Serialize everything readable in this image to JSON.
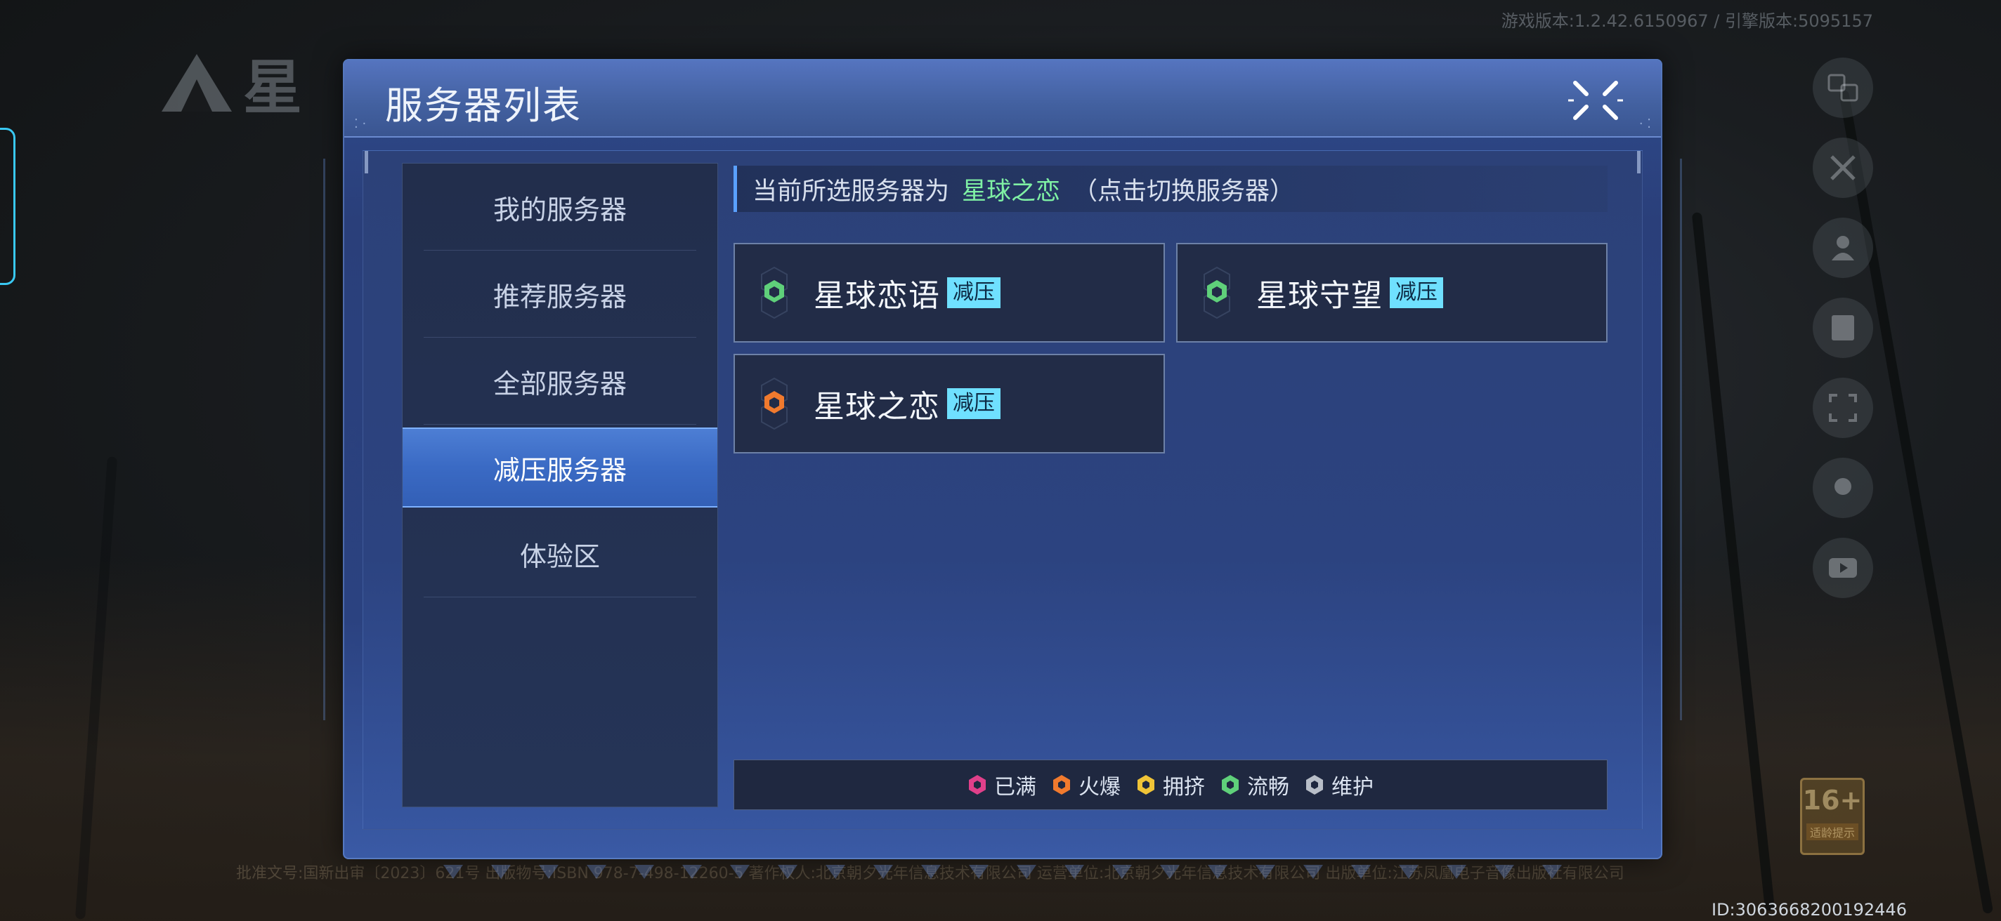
{
  "background": {
    "version_text": "游戏版本:1.2.42.6150967 / 引擎版本:5095157",
    "license_text": "批准文号:国新出审〔2023〕621号 出版物号:ISBN 978-7-498-12260-5 著作权人:北京朝夕光年信息技术有限公司 运营单位:北京朝夕光年信息技术有限公司 出版单位:江苏凤凰电子音像出版社有限公司",
    "id_text": "ID:3063668200192446",
    "age_badge": {
      "number": "16+",
      "caption": "适龄提示"
    }
  },
  "dialog": {
    "title": "服务器列表",
    "close_icon": "close-x-icon"
  },
  "sidebar": {
    "items": [
      {
        "label": "我的服务器",
        "active": false
      },
      {
        "label": "推荐服务器",
        "active": false
      },
      {
        "label": "全部服务器",
        "active": false
      },
      {
        "label": "减压服务器",
        "active": true
      },
      {
        "label": "体验区",
        "active": false
      }
    ]
  },
  "current": {
    "prefix": "当前所选服务器为",
    "server": "星球之恋",
    "hint": "（点击切换服务器）"
  },
  "servers": [
    {
      "name": "星球恋语",
      "tag": "减压",
      "status": "流畅"
    },
    {
      "name": "星球守望",
      "tag": "减压",
      "status": "流畅"
    },
    {
      "name": "星球之恋",
      "tag": "减压",
      "status": "火爆"
    }
  ],
  "legend": [
    {
      "label": "已满",
      "color": "#e0408a"
    },
    {
      "label": "火爆",
      "color": "#f07a2e"
    },
    {
      "label": "拥挤",
      "color": "#f0c437"
    },
    {
      "label": "流畅",
      "color": "#5fd07a"
    },
    {
      "label": "维护",
      "color": "#b8bec8"
    }
  ],
  "colors": {
    "accent": "#5aa0ff",
    "selected_server_text": "#7ff0a4",
    "tag_bg": "#6fe0ff",
    "active_tab": "#3a6ac4"
  },
  "side_buttons": [
    "translate-icon",
    "tools-icon",
    "user-icon",
    "notice-icon",
    "scan-icon",
    "support-icon",
    "video-icon"
  ]
}
